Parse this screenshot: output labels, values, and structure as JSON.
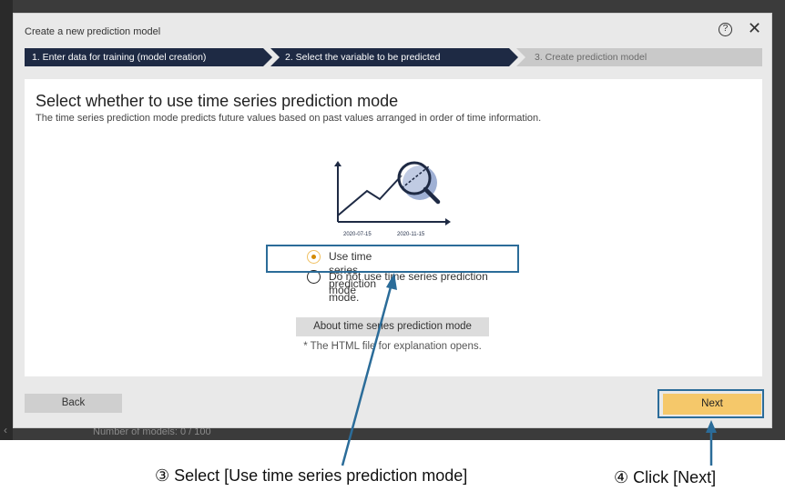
{
  "app": {
    "footer_text": "Number of models: 0 / 100",
    "chevron": "‹"
  },
  "dialog": {
    "title": "Create a new prediction model",
    "help_symbol": "?",
    "close_symbol": "✕",
    "steps": [
      {
        "label": "1. Enter data for training (model creation)",
        "state": "done"
      },
      {
        "label": "2. Select the variable to be predicted",
        "state": "active"
      },
      {
        "label": "3. Create prediction model",
        "state": "pending"
      }
    ],
    "heading": "Select whether to use time series prediction mode",
    "subheading": "The time series prediction mode predicts future values based on past values arranged in order of time information.",
    "illustration": {
      "date_left": "2020-07-15",
      "date_right": "2020-11-15",
      "icon": "line-chart-magnifier-icon"
    },
    "options": [
      {
        "label": "Use time series prediction mode.",
        "selected": true
      },
      {
        "label": "Do not use time series prediction mode",
        "selected": false
      }
    ],
    "about_button": "About time series prediction mode",
    "about_note": "* The HTML file for explanation opens.",
    "back_button": "Back",
    "next_button": "Next"
  },
  "annotations": {
    "caption_select": "③ Select [Use time series prediction mode]",
    "caption_next": "④ Click [Next]",
    "color": "#2b6c99"
  },
  "colors": {
    "step_active": "#1e2a44",
    "step_pending": "#c9c9c9",
    "next_button": "#f5c86a",
    "radio_selected": "#d48a00"
  }
}
